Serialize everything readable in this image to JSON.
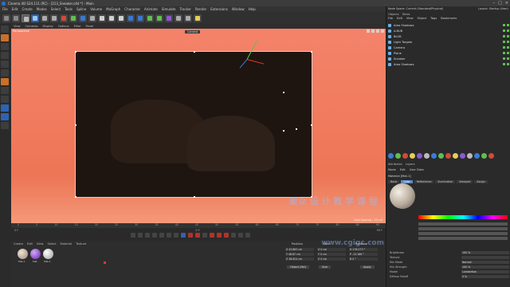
{
  "window": {
    "title": "Cinema 4D S24.111 (RC) - [213_Sneaker.c4d *] - Main"
  },
  "menu": [
    "File",
    "Edit",
    "Create",
    "Modes",
    "Select",
    "Tools",
    "Spline",
    "Volume",
    "MoGraph",
    "Character",
    "Animate",
    "Simulate",
    "Tracker",
    "Render",
    "Extensions",
    "Window",
    "Help"
  ],
  "viewport": {
    "menu": [
      "View",
      "Cameras",
      "Display",
      "Options",
      "Filter",
      "Panel"
    ],
    "name": "Perspective",
    "camera": "Camera",
    "grid_spacing": "Grid Spacing : 10 cm",
    "render_bg": "#1e1510",
    "bg_color": "#f07a5c"
  },
  "watermark": {
    "line1": "聚众 设 计 教 学 课 程",
    "line2": "www.cgigc.com"
  },
  "timeline": {
    "ruler": [
      "0",
      "5",
      "10",
      "15",
      "20",
      "25",
      "30",
      "35",
      "40",
      "45",
      "50",
      "55",
      "60",
      "65",
      "70",
      "75",
      "80",
      "85",
      "90"
    ],
    "start": "0 F",
    "end": "90 F",
    "current": "0 F"
  },
  "materials": {
    "menu": [
      "Create",
      "Edit",
      "View",
      "Select",
      "Material",
      "Texture"
    ],
    "items": [
      {
        "label": "Mat.1",
        "color": "#b9a493"
      },
      {
        "label": "Mat",
        "color": "#8a3fd1"
      },
      {
        "label": "Mat.2",
        "color": "#dedede"
      }
    ]
  },
  "coords": {
    "headers": [
      "Position",
      "Size",
      "Rotation"
    ],
    "rows": [
      [
        "X 43.883 cm",
        "X 0 cm",
        "H 178.273 °"
      ],
      [
        "Y 48.87 cm",
        "Y 0 cm",
        "P -13.186 °"
      ],
      [
        "Z 38.624 cm",
        "Z 0 cm",
        "B 0 °"
      ]
    ],
    "mode": "Object (Rel)",
    "size_mode": "Size",
    "apply": "Apply"
  },
  "right_panel": {
    "layout_label": "Node Space:",
    "layout_value": "Current (Standard/Physical)",
    "layout_right": "Layout:",
    "layout_right_value": "Startup (User)",
    "tabs": [
      "Objects",
      "Takes"
    ],
    "obj_menu": [
      "File",
      "Edit",
      "View",
      "Object",
      "Tags",
      "Bookmarks"
    ],
    "objects": [
      "Area Shadows",
      "A.BUB",
      "BLOB",
      "Light Targets",
      "Camera",
      "Plane",
      "Sneaker",
      "Area Shadows"
    ],
    "attr_tabs": [
      "Attributes",
      "Layers"
    ],
    "attr_menu": [
      "Mode",
      "Edit",
      "User Data"
    ],
    "material_name": "Material [Mat.1]",
    "channel_tabs": [
      "Basic",
      "Color",
      "Reflectance",
      "Illumination",
      "Viewport",
      "Assign"
    ],
    "rows": [
      {
        "label": "Brightness",
        "value": "100 %"
      },
      {
        "label": "Texture",
        "value": ""
      },
      {
        "label": "Mix Mode",
        "value": "Normal"
      },
      {
        "label": "Mix Strength",
        "value": "100 %"
      },
      {
        "label": "Model",
        "value": "Lambertian"
      },
      {
        "label": "Diffuse Falloff",
        "value": "0 %"
      }
    ]
  }
}
